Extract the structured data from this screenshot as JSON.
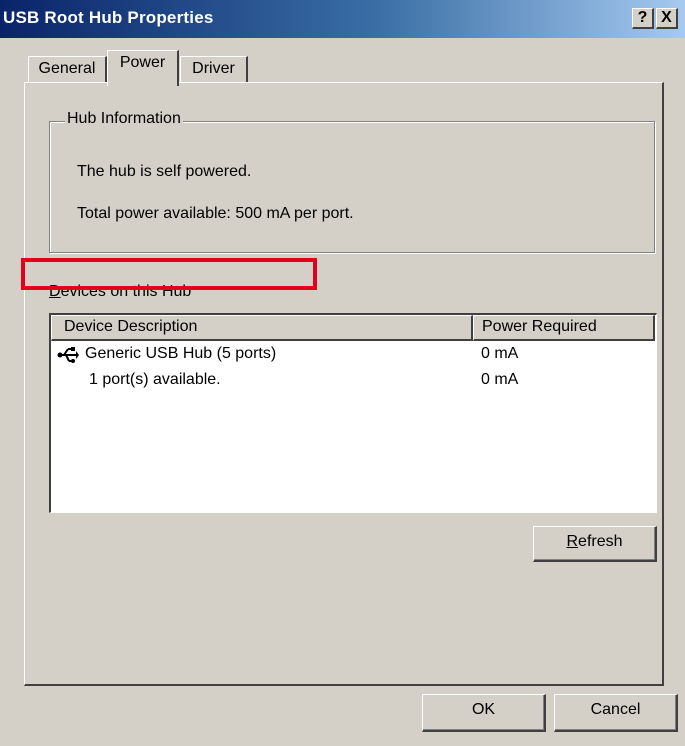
{
  "window": {
    "title": "USB Root Hub Properties",
    "help_label": "?",
    "close_label": "X"
  },
  "tabs": [
    {
      "label": "General",
      "selected": false
    },
    {
      "label": "Power",
      "selected": true
    },
    {
      "label": "Driver",
      "selected": false
    }
  ],
  "hub_info": {
    "group_label": "Hub Information",
    "line1": "The hub is self powered.",
    "line2": "Total power available:  500 mA per port."
  },
  "devices": {
    "label_mnemonic": "D",
    "label_rest": "evices on this Hub",
    "columns": [
      "Device Description",
      "Power Required"
    ],
    "rows": [
      {
        "icon": "usb-icon",
        "description": "Generic USB Hub (5 ports)",
        "power": "0 mA",
        "highlighted": true
      },
      {
        "icon": "",
        "description": "1 port(s) available.",
        "power": "0 mA",
        "highlighted": false
      }
    ]
  },
  "buttons": {
    "refresh_mnemonic": "R",
    "refresh_rest": "efresh",
    "ok": "OK",
    "cancel": "Cancel"
  },
  "colors": {
    "highlight_border": "#e3001b",
    "dialog_face": "#d4d0c8",
    "title_start": "#0a246a"
  }
}
